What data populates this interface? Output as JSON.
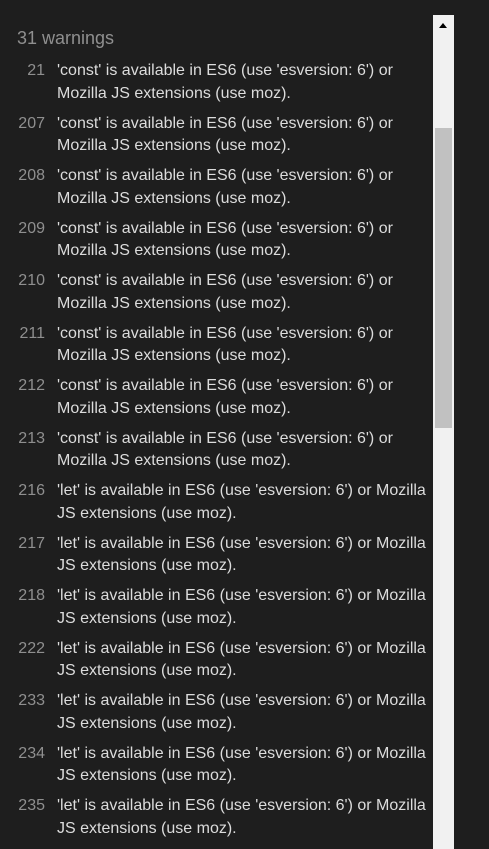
{
  "header": {
    "title": "31 warnings"
  },
  "warnings": [
    {
      "line": "21",
      "message": "'const' is available in ES6 (use 'esversion: 6') or Mozilla JS extensions (use moz)."
    },
    {
      "line": "207",
      "message": "'const' is available in ES6 (use 'esversion: 6') or Mozilla JS extensions (use moz)."
    },
    {
      "line": "208",
      "message": "'const' is available in ES6 (use 'esversion: 6') or Mozilla JS extensions (use moz)."
    },
    {
      "line": "209",
      "message": "'const' is available in ES6 (use 'esversion: 6') or Mozilla JS extensions (use moz)."
    },
    {
      "line": "210",
      "message": "'const' is available in ES6 (use 'esversion: 6') or Mozilla JS extensions (use moz)."
    },
    {
      "line": "211",
      "message": "'const' is available in ES6 (use 'esversion: 6') or Mozilla JS extensions (use moz)."
    },
    {
      "line": "212",
      "message": "'const' is available in ES6 (use 'esversion: 6') or Mozilla JS extensions (use moz)."
    },
    {
      "line": "213",
      "message": "'const' is available in ES6 (use 'esversion: 6') or Mozilla JS extensions (use moz)."
    },
    {
      "line": "216",
      "message": "'let' is available in ES6 (use 'esversion: 6') or Mozilla JS extensions (use moz)."
    },
    {
      "line": "217",
      "message": "'let' is available in ES6 (use 'esversion: 6') or Mozilla JS extensions (use moz)."
    },
    {
      "line": "218",
      "message": "'let' is available in ES6 (use 'esversion: 6') or Mozilla JS extensions (use moz)."
    },
    {
      "line": "222",
      "message": "'let' is available in ES6 (use 'esversion: 6') or Mozilla JS extensions (use moz)."
    },
    {
      "line": "233",
      "message": "'let' is available in ES6 (use 'esversion: 6') or Mozilla JS extensions (use moz)."
    },
    {
      "line": "234",
      "message": "'let' is available in ES6 (use 'esversion: 6') or Mozilla JS extensions (use moz)."
    },
    {
      "line": "235",
      "message": "'let' is available in ES6 (use 'esversion: 6') or Mozilla JS extensions (use moz)."
    }
  ],
  "scrollbar": {
    "up_icon": "chevron-up-icon"
  },
  "colors": {
    "background": "#1e1e1e",
    "text": "#dcdcdc",
    "muted": "#8f8f8f",
    "scroll_track": "#f1f1f1",
    "scroll_thumb": "#c1c1c1"
  }
}
